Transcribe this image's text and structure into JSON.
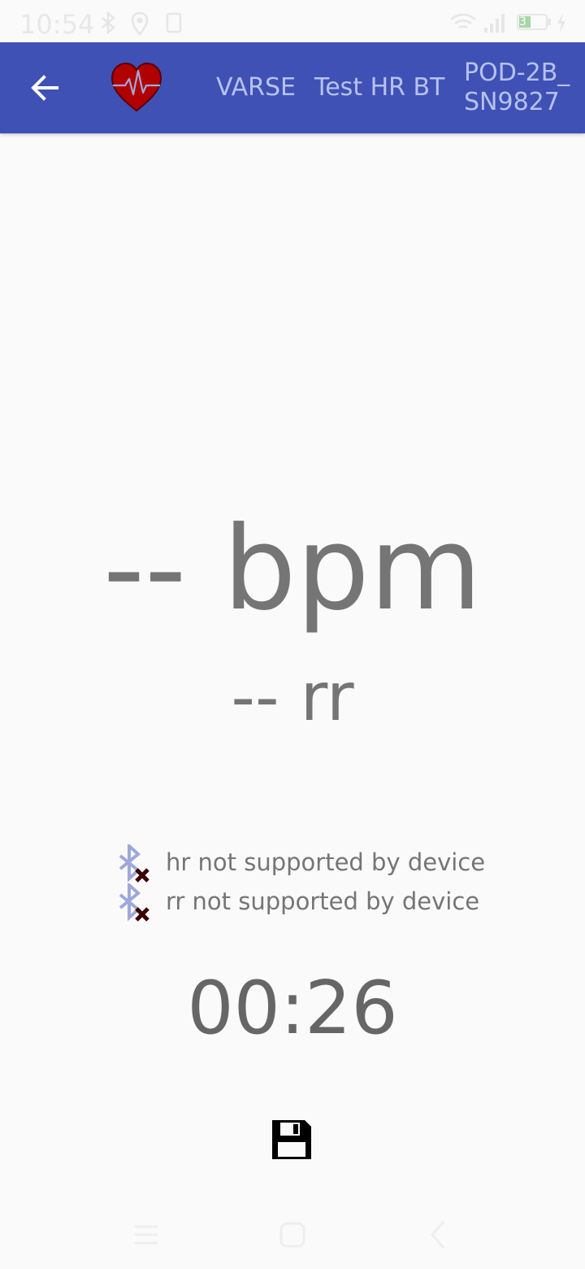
{
  "status_bar": {
    "time": "10:54",
    "battery_level": "3"
  },
  "toolbar": {
    "back_icon": "arrow-back-icon",
    "logo_icon": "heart-pulse-icon",
    "app_name": "VARSE",
    "screen_title": "Test HR BT",
    "device_name": "POD-2B_ SN9827"
  },
  "readings": {
    "heart_rate": "-- bpm",
    "rr_interval": "-- rr"
  },
  "support": [
    {
      "icon": "bluetooth-disabled-icon",
      "text": "hr not supported by device"
    },
    {
      "icon": "bluetooth-disabled-icon",
      "text": "rr not supported by device"
    }
  ],
  "timer": {
    "elapsed": "00:26"
  },
  "actions": {
    "save_icon": "save-icon"
  },
  "navigation": {
    "icons": [
      "menu-icon",
      "home-icon",
      "back-icon"
    ]
  },
  "colors": {
    "app_bar": "#3f51b5",
    "toolbar_text": "#b7c1ee",
    "reading_text": "#757575",
    "logo_heart": "#b00000",
    "bt_icon": "#9fa8da",
    "bt_error_mark": "#3a0000"
  }
}
